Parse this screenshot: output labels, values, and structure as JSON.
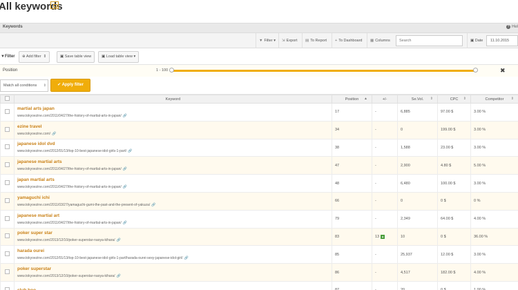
{
  "page": {
    "title": "All keywords"
  },
  "section": {
    "label": "Keywords",
    "help": "Hel"
  },
  "toolbar": {
    "filter": "Filter",
    "export": "Export",
    "to_report": "To Report",
    "to_dashboard": "To Dashboard",
    "columns": "Columns",
    "search_placeholder": "Search",
    "date_label": "Date",
    "date_value": "11.10.2015"
  },
  "filters": {
    "label": "Filter",
    "add_filter": "Add filter",
    "save_view": "Save table view",
    "load_view": "Load table view"
  },
  "position_filter": {
    "label": "Position",
    "range": "1 - 100"
  },
  "apply": {
    "match": "Match all conditions",
    "button": "Apply filter"
  },
  "columns": {
    "keyword": "Keyword",
    "position": "Position",
    "change": "+/-",
    "volume": "Se.Vol.",
    "cpc": "CPC",
    "competitor": "Competitor"
  },
  "rows": [
    {
      "keyword": "martial arts japan",
      "url": "www.tokyoezine.com/2011/04/27/the-history-of-martial-arts-in-japan/",
      "position": "17",
      "change": "-",
      "volume": "6,885",
      "cpc": "97.00 $",
      "competitor": "3.00 %"
    },
    {
      "keyword": "ezine travel",
      "url": "www.tokyoezine.com/",
      "position": "34",
      "change": "-",
      "volume": "0",
      "cpc": "199.00 $",
      "competitor": "3.00 %"
    },
    {
      "keyword": "japanese idol dvd",
      "url": "www.tokyoezine.com/2012/01/13/top-10-best-japanese-idol-girls-1-part/",
      "position": "38",
      "change": "-",
      "volume": "1,588",
      "cpc": "23.00 $",
      "competitor": "3.00 %"
    },
    {
      "keyword": "japanese martial arts",
      "url": "www.tokyoezine.com/2011/04/27/the-history-of-martial-arts-in-japan/",
      "position": "47",
      "change": "-",
      "volume": "2,900",
      "cpc": "4.80 $",
      "competitor": "5.00 %"
    },
    {
      "keyword": "japan martial arts",
      "url": "www.tokyoezine.com/2011/04/27/the-history-of-martial-arts-in-japan/",
      "position": "48",
      "change": "-",
      "volume": "6,480",
      "cpc": "100.00 $",
      "competitor": "3.00 %"
    },
    {
      "keyword": "yamaguchi ichi",
      "url": "www.tokyoezine.com/2011/03/27/yamaguchi-gumi-the-past-and-the-present-of-yakuza/",
      "position": "66",
      "change": "-",
      "volume": "0",
      "cpc": "0 $",
      "competitor": "0 %"
    },
    {
      "keyword": "japanese martial art",
      "url": "www.tokyoezine.com/2011/04/27/the-history-of-martial-arts-in-japan/",
      "position": "79",
      "change": "-",
      "volume": "2,349",
      "cpc": "64.00 $",
      "competitor": "4.00 %"
    },
    {
      "keyword": "poker super star",
      "url": "www.tokyoezine.com/2013/12/10/poker-superstar-naoya-kihara/",
      "position": "83",
      "change": "13",
      "volume": "10",
      "cpc": "0 $",
      "competitor": "36.00 %"
    },
    {
      "keyword": "harada ourei",
      "url": "www.tokyoezine.com/2012/01/13/top-10-best-japanese-idol-girls-1-part/harada-ourei-sexy-japanese-idol-girl/",
      "position": "85",
      "change": "-",
      "volume": "25,937",
      "cpc": "12.00 $",
      "competitor": "3.00 %"
    },
    {
      "keyword": "poker superstar",
      "url": "www.tokyoezine.com/2013/12/10/poker-superstar-naoya-kihara/",
      "position": "86",
      "change": "-",
      "volume": "4,517",
      "cpc": "182.00 $",
      "competitor": "4.00 %"
    },
    {
      "keyword": "club boo",
      "url": "",
      "position": "87",
      "change": "-",
      "volume": "20",
      "cpc": "0 $",
      "competitor": "1.00 %"
    }
  ],
  "colors": {
    "accent": "#f0ad0a",
    "keyword_link": "#c98118",
    "alt_row": "#fffaee"
  }
}
